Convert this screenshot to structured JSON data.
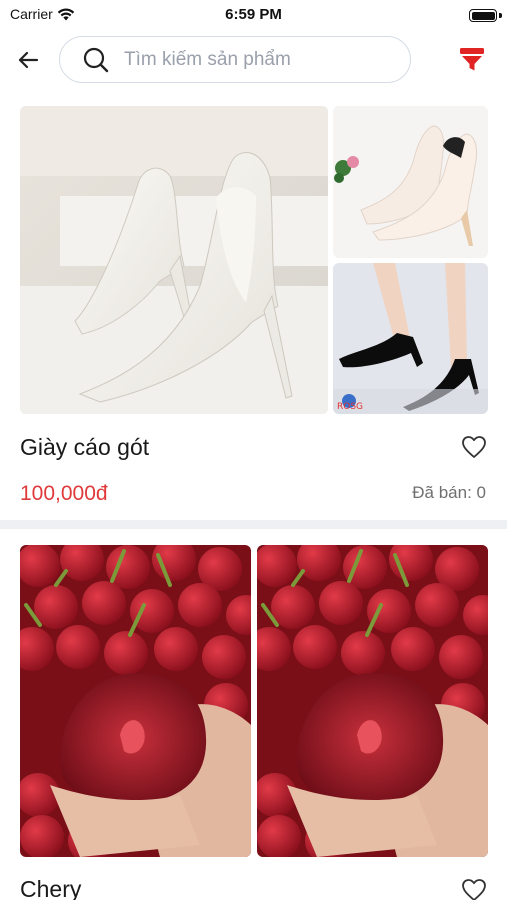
{
  "status_bar": {
    "carrier": "Carrier",
    "time": "6:59 PM",
    "battery_level": 1.0
  },
  "header": {
    "back_icon": "arrow-left-icon",
    "search": {
      "placeholder": "Tìm kiếm sản phẩm",
      "value": "",
      "icon": "search-icon"
    },
    "filter_icon": "filter-funnel-icon",
    "filter_color": "#e02424"
  },
  "products": [
    {
      "name": "Giày cáo gót",
      "price": "100,000đ",
      "sold_text": "Đã bán: 0",
      "favorite_icon": "heart-outline-icon",
      "images": [
        "white-heels-photo",
        "white-heels-roses-photo",
        "black-heels-legs-photo"
      ],
      "watermark": "ROSG"
    },
    {
      "name": "Chery",
      "favorite_icon": "heart-outline-icon",
      "images": [
        "cherry-halved-photo",
        "cherry-halved-photo"
      ]
    }
  ],
  "colors": {
    "price": "#e03a3a",
    "divider": "#eef0f3",
    "search_border": "#d6dbe6"
  }
}
